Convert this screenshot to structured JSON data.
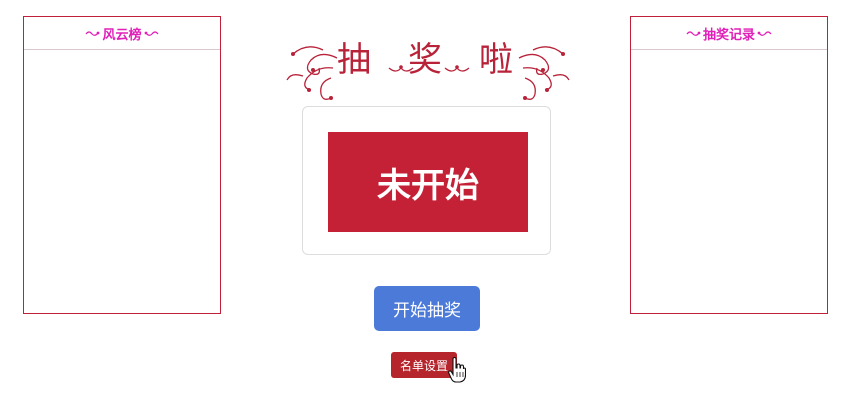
{
  "leaderboard": {
    "title": "风云榜"
  },
  "records": {
    "title": "抽奖记录"
  },
  "header": {
    "chars": [
      "抽",
      "奖",
      "啦"
    ]
  },
  "display": {
    "status": "未开始"
  },
  "controls": {
    "start_label": "开始抽奖",
    "list_settings_label": "名单设置"
  },
  "colors": {
    "accent": "#c42136",
    "panel_title": "#e020b8",
    "primary_button": "#4b7ad9",
    "secondary_button": "#b6242c"
  },
  "icons": {
    "title_ornament": "swirl-ornament-icon",
    "panel_ornament": "scroll-ornament-icon",
    "cursor": "hand-pointer-icon"
  }
}
